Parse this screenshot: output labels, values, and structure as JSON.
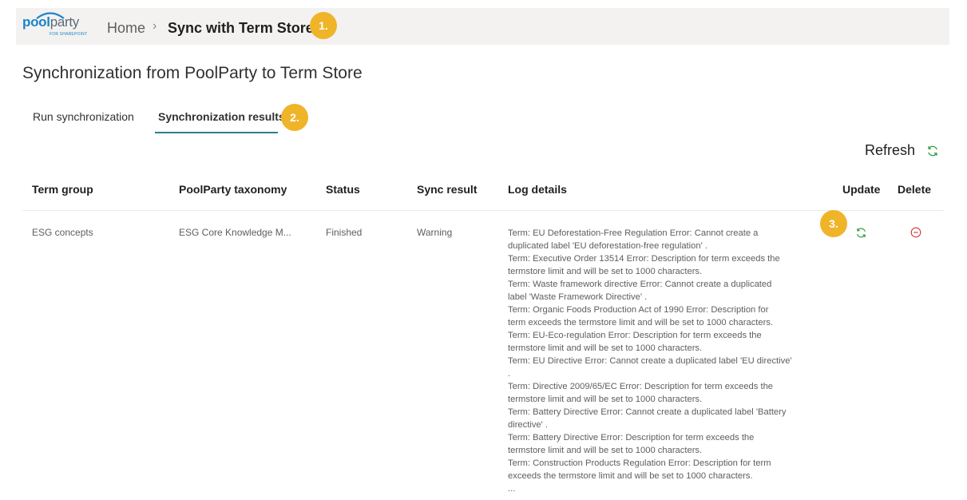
{
  "header": {
    "logo_text_pool": "pool",
    "logo_text_party": "party",
    "logo_subtitle": "FOR SHAREPOINT",
    "breadcrumb_home": "Home",
    "breadcrumb_separator": "›",
    "breadcrumb_current": "Sync with Term Store",
    "badge_1": "1."
  },
  "page": {
    "title": "Synchronization from PoolParty to Term Store"
  },
  "tabs": [
    {
      "label": "Run synchronization",
      "active": false
    },
    {
      "label": "Synchronization results",
      "active": true
    }
  ],
  "badge_2": "2.",
  "badge_3": "3.",
  "toolbar": {
    "refresh_label": "Refresh",
    "refresh_icon": "sync-icon"
  },
  "table": {
    "columns": [
      "Term group",
      "PoolParty taxonomy",
      "Status",
      "Sync result",
      "Log details",
      "Update",
      "Delete"
    ],
    "rows": [
      {
        "term_group": "ESG concepts",
        "taxonomy": "ESG Core Knowledge M...",
        "status": "Finished",
        "sync_result": "Warning",
        "log_lines": [
          "Term: EU Deforestation-Free Regulation Error: Cannot create a",
          "duplicated label 'EU deforestation-free regulation' .",
          "Term: Executive Order 13514 Error: Description for term exceeds the",
          "termstore limit and will be set to 1000 characters.",
          "Term: Waste framework directive Error: Cannot create a duplicated",
          "label 'Waste Framework Directive' .",
          "Term: Organic Foods Production Act of 1990 Error: Description for",
          "term exceeds the termstore limit and will be set to 1000 characters.",
          "Term: EU-Eco-regulation Error: Description for term exceeds the",
          "termstore limit and will be set to 1000 characters.",
          "Term: EU Directive Error: Cannot create a duplicated label 'EU directive'",
          ".",
          "Term: Directive 2009/65/EC Error: Description for term exceeds the",
          "termstore limit and will be set to 1000 characters.",
          "Term: Battery Directive Error: Cannot create a duplicated label 'Battery",
          "directive' .",
          "Term: Battery Directive Error: Description for term exceeds the",
          "termstore limit and will be set to 1000 characters.",
          "Term: Construction Products Regulation Error: Description for term",
          "exceeds the termstore limit and will be set to 1000 characters.",
          "..."
        ],
        "update_icon": "sync-icon",
        "delete_icon": "remove-circle-icon"
      }
    ]
  },
  "colors": {
    "accent": "#2f7d8c",
    "badge": "#f0b429",
    "sync_green": "#2e9e3e",
    "delete_red": "#d13438"
  }
}
